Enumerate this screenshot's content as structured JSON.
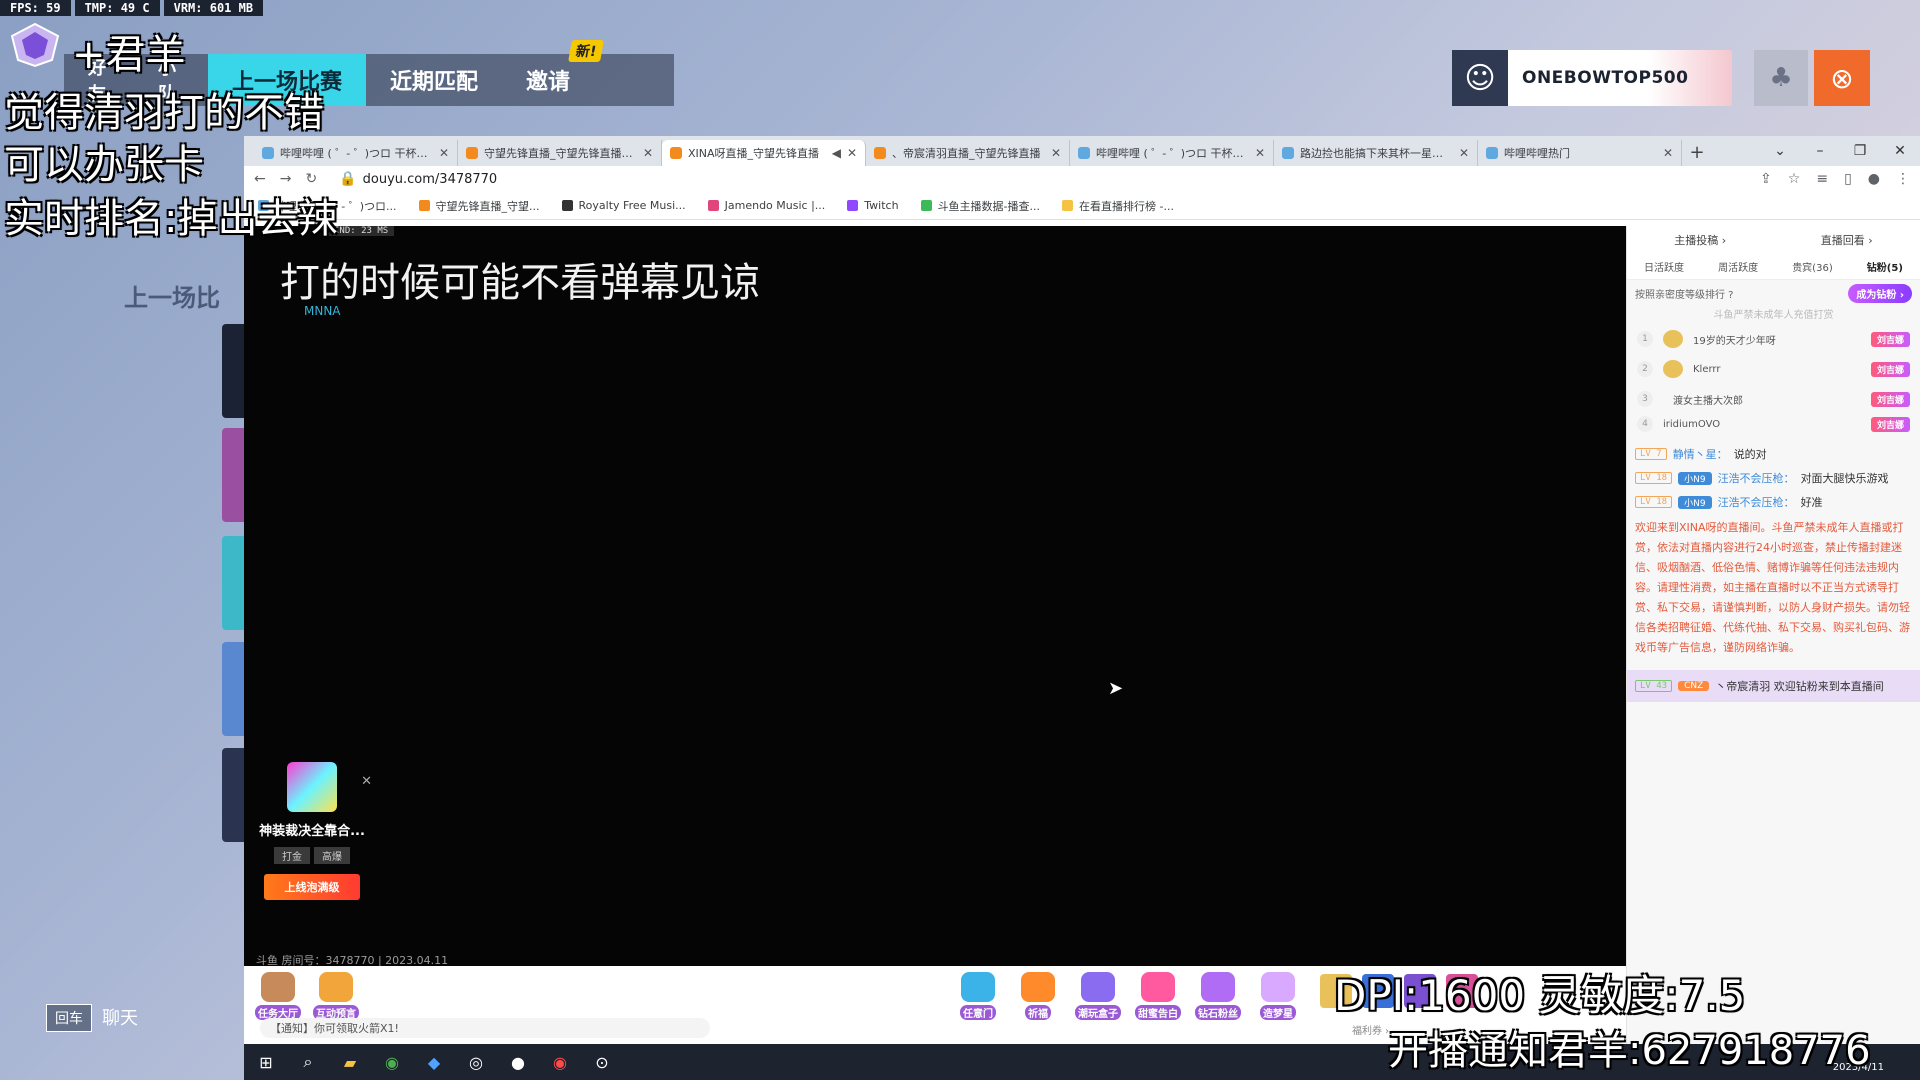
{
  "hud": {
    "fps": "FPS: 59",
    "tmp": "TMP: 49 C",
    "vrm": "VRM: 601 MB"
  },
  "lobby": {
    "nav": [
      {
        "label": "好友"
      },
      {
        "label": "小队"
      },
      {
        "label": "上一场比赛"
      },
      {
        "label": "近期匹配"
      },
      {
        "label": "邀请"
      }
    ],
    "new_badge": "新!",
    "section_title": "上一场比",
    "profile_name": "ONEBOWTOP500",
    "back_button": "回车",
    "chat_label": "聊天"
  },
  "browser": {
    "tabs": [
      {
        "title": "哔哩哔哩 ( ゜- ゜)つロ 干杯~-bili"
      },
      {
        "title": "守望先锋直播_守望先锋直播解说"
      },
      {
        "title": "XINA呀直播_守望先锋直播"
      },
      {
        "title": "、帝宸清羽直播_守望先锋直播"
      },
      {
        "title": "哔哩哔哩 ( ゜- ゜)つロ 干杯~-bili"
      },
      {
        "title": "路边捡也能搞下来其杯一星？全"
      },
      {
        "title": "哔哩哔哩热门"
      }
    ],
    "url": "douyu.com/3478770",
    "bookmarks": [
      {
        "label": "哔哩哔哩 ( ゜- ゜)つロ..."
      },
      {
        "label": "守望先锋直播_守望..."
      },
      {
        "label": "Royalty Free Musi..."
      },
      {
        "label": "Jamendo Music |..."
      },
      {
        "label": "Twitch"
      },
      {
        "label": "斗鱼主播数据-播查..."
      },
      {
        "label": "在看直播排行榜 -..."
      }
    ]
  },
  "player": {
    "net_tag": "IND: 23 MS",
    "danmaku": "打的时候可能不看弹幕见谅",
    "danmaku_user": "MNNA",
    "ad": {
      "title": "神装裁决全靠合...",
      "tag1": "打金",
      "tag2": "高爆",
      "cta": "上线泡满级"
    },
    "room_info": "斗鱼 房间号：3478770 | 2023.04.11",
    "notice": "【通知】你可领取火箭X1!",
    "welfare": "福利券 ›",
    "left_buttons": [
      {
        "label": "任务大厅",
        "color": "#c78a5a"
      },
      {
        "label": "互动预言",
        "color": "#f2a53a"
      }
    ],
    "right_buttons": [
      {
        "label": "任意门",
        "color": "#3bb3e8"
      },
      {
        "label": "祈福",
        "color": "#ff8a2b"
      },
      {
        "label": "潮玩盒子",
        "color": "#8a6cf0"
      },
      {
        "label": "甜蜜告白",
        "color": "#ff5aa0"
      },
      {
        "label": "钻石粉丝",
        "color": "#b06cf5"
      },
      {
        "label": "造梦星",
        "color": "#d9a8ff"
      }
    ]
  },
  "sidebar": {
    "top_links": [
      "主播投稿 ›",
      "直播回看 ›"
    ],
    "tabs": [
      "日活跃度",
      "周活跃度",
      "贵宾(36)",
      "钻粉(5)"
    ],
    "rank_title": "按照亲密度等级排行 ?",
    "fan_button": "成为钻粉 ›",
    "rank_note": "斗鱼严禁未成年人充值打赏",
    "ranks": [
      {
        "num": "1",
        "name": "19岁的天才少年呀",
        "badge": "刘吉娜"
      },
      {
        "num": "2",
        "name": "Klerrr",
        "badge": "刘吉娜"
      },
      {
        "num": "3",
        "name": "渡女主播大次郎",
        "badge": "刘吉娜"
      },
      {
        "num": "4",
        "name": "iridiumOVO",
        "badge": "刘吉娜"
      }
    ],
    "messages": [
      {
        "lv": "LV 7",
        "medal": "",
        "nick": "静情丶星：",
        "text": "说的对"
      },
      {
        "lv": "LV 18",
        "medal": "小N9",
        "nick": "汪浩不会压枪：",
        "text": "对面大腿快乐游戏"
      },
      {
        "lv": "LV 18",
        "medal": "小N9",
        "nick": "汪浩不会压枪：",
        "text": "好准"
      }
    ],
    "system_message": "欢迎来到XINA呀的直播间。斗鱼严禁未成年人直播或打赏，依法对直播内容进行24小时巡查，禁止传播封建迷信、吸烟酗酒、低俗色情、赌博诈骗等任何违法违规内容。请理性消费，如主播在直播时以不正当方式诱导打赏、私下交易，请谨慎判断，以防人身财产损失。请勿轻信各类招聘征婚、代练代抽、私下交易、购买礼包码、游戏币等广告信息，谨防网络诈骗。",
    "welcome": {
      "lv": "LV 43",
      "medal": "CNZ",
      "text": "丶帝宸清羽 欢迎钻粉来到本直播间"
    }
  },
  "taskbar": {
    "time": "2023/4/11"
  },
  "overlay": {
    "name": "+君羊",
    "line1": "觉得清羽打的不错",
    "line2": "可以办张卡",
    "line3": "实时排名:掉出去辣",
    "dpi": "DPI:1600 灵敏度:7.5",
    "notice": "开播通知君羊:627918776"
  }
}
